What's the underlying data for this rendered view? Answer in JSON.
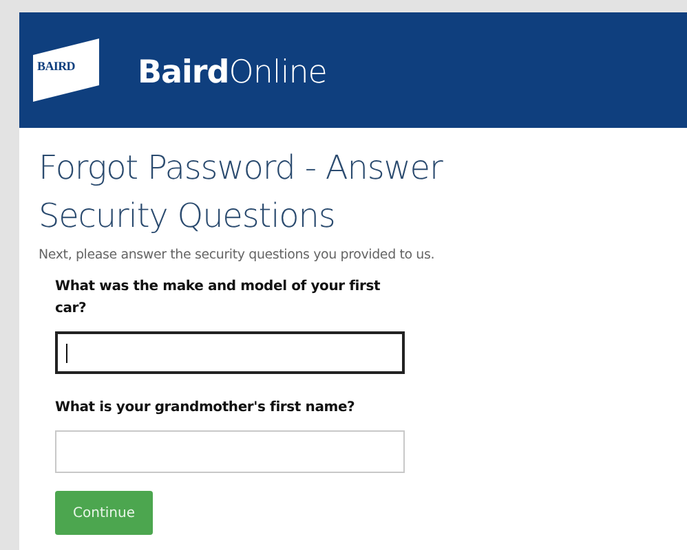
{
  "header": {
    "logo_text": "BAIRD",
    "brand": "**Baird**Online"
  },
  "title": "Forgot Password - Answer Security Questions",
  "intro": "Next, please answer the security questions you provided to us.",
  "questions": [
    {
      "label": "What was the make and model of your first car?",
      "focused": true
    },
    {
      "label": "What is your grandmother's first name?",
      "focused": false
    }
  ],
  "button": "Continue"
}
